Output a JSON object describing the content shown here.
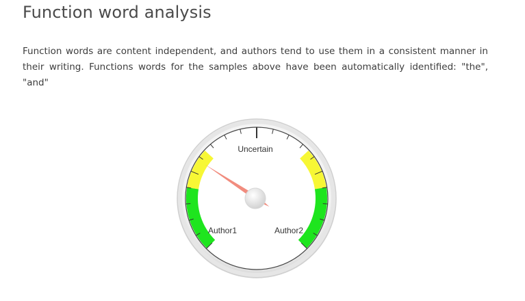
{
  "section": {
    "title": "Function word analysis",
    "description": "Function words are content independent, and authors tend to use them in a consistent manner in their writing. Functions words for the samples above have been automatically identified: \"the\", \"and\""
  },
  "gauge": {
    "center_label": "Uncertain",
    "left_label": "Author1",
    "right_label": "Author2",
    "needle_value": -0.42,
    "value_range": [
      -1,
      1
    ],
    "bands": [
      {
        "from": -1.0,
        "to": -0.6,
        "color": "#1ee51e"
      },
      {
        "from": -0.6,
        "to": -0.35,
        "color": "#f7f735"
      },
      {
        "from": 0.35,
        "to": 0.6,
        "color": "#f7f735"
      },
      {
        "from": 0.6,
        "to": 1.0,
        "color": "#1ee51e"
      }
    ],
    "needle_color": "#f08070"
  }
}
